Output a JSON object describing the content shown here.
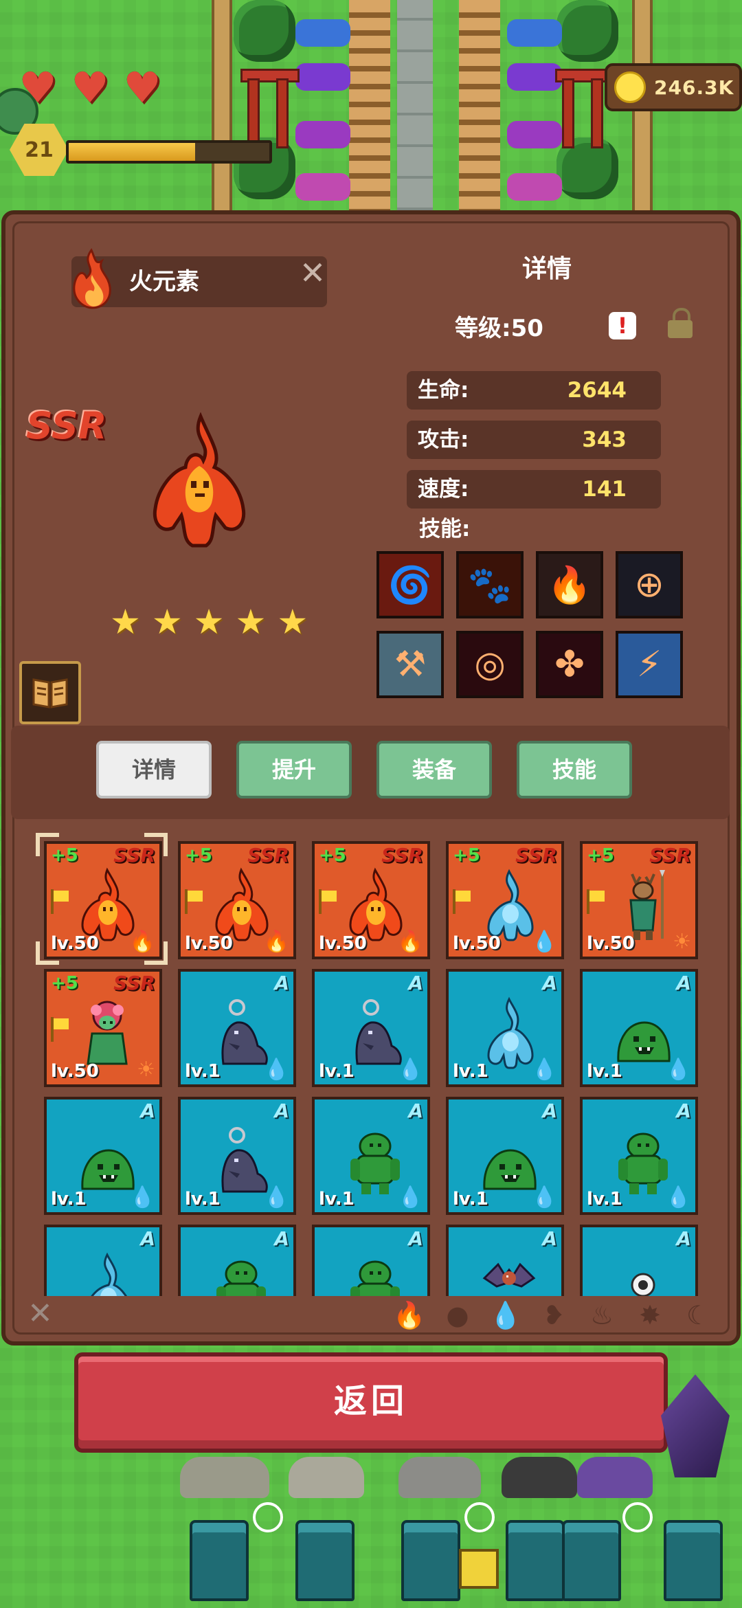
{
  "hud": {
    "player_level": "21",
    "xp_progress": 0.63,
    "hearts": [
      "heart",
      "heart",
      "heart"
    ],
    "gold": "246.3K"
  },
  "hero": {
    "name": "火元素",
    "rarity": "SSR",
    "stars": 5,
    "star_glyph": "★",
    "close_glyph": "✕"
  },
  "details": {
    "title": "详情",
    "level": "等级:50",
    "alert_glyph": "!",
    "stats": [
      {
        "label": "生命:",
        "value": "2644"
      },
      {
        "label": "攻击:",
        "value": "343"
      },
      {
        "label": "速度:",
        "value": "141"
      }
    ],
    "skills_label": "技能:",
    "skills": [
      {
        "icon": "fire-swirl-icon",
        "glyph": "🌀",
        "color": "#6a1a10"
      },
      {
        "icon": "fire-beast-icon",
        "glyph": "🐾",
        "color": "#3a1208"
      },
      {
        "icon": "flame-spirit-icon",
        "glyph": "🔥",
        "color": "#2a1a18"
      },
      {
        "icon": "crosshair-icon",
        "glyph": "⊕",
        "color": "#1a1a24"
      },
      {
        "icon": "pillar-icon",
        "glyph": "⚒",
        "color": "#4a6a7a"
      },
      {
        "icon": "blood-ring-icon",
        "glyph": "◎",
        "color": "#2a0a0e"
      },
      {
        "icon": "blood-drops-icon",
        "glyph": "✤",
        "color": "#2a0a10"
      },
      {
        "icon": "lightning-icon",
        "glyph": "⚡",
        "color": "#2a5a9a"
      }
    ]
  },
  "tabs": [
    {
      "label": "详情",
      "active": true
    },
    {
      "label": "提升",
      "active": false
    },
    {
      "label": "装备",
      "active": false
    },
    {
      "label": "技能",
      "active": false
    }
  ],
  "cards": [
    {
      "rarity": "SSR",
      "bonus": "+5",
      "level": "lv.50",
      "element": "fire",
      "monster": "fire-elemental",
      "flag": true,
      "selected": true
    },
    {
      "rarity": "SSR",
      "bonus": "+5",
      "level": "lv.50",
      "element": "fire",
      "monster": "fire-elemental",
      "flag": true
    },
    {
      "rarity": "SSR",
      "bonus": "+5",
      "level": "lv.50",
      "element": "fire",
      "monster": "fire-elemental",
      "flag": true
    },
    {
      "rarity": "SSR",
      "bonus": "+5",
      "level": "lv.50",
      "element": "water",
      "monster": "water-elemental",
      "flag": true
    },
    {
      "rarity": "SSR",
      "bonus": "+5",
      "level": "lv.50",
      "element": "sun",
      "monster": "deer-spearman",
      "flag": true
    },
    {
      "rarity": "SSR",
      "bonus": "+5",
      "level": "lv.50",
      "element": "sun",
      "monster": "flower-maiden",
      "flag": true
    },
    {
      "rarity": "A",
      "bonus": "",
      "level": "lv.1",
      "element": "water",
      "monster": "shadow-wolf"
    },
    {
      "rarity": "A",
      "bonus": "",
      "level": "lv.1",
      "element": "water",
      "monster": "shadow-wolf"
    },
    {
      "rarity": "A",
      "bonus": "",
      "level": "lv.1",
      "element": "water",
      "monster": "water-elemental"
    },
    {
      "rarity": "A",
      "bonus": "",
      "level": "lv.1",
      "element": "water",
      "monster": "green-slime"
    },
    {
      "rarity": "A",
      "bonus": "",
      "level": "lv.1",
      "element": "water",
      "monster": "green-slime"
    },
    {
      "rarity": "A",
      "bonus": "",
      "level": "lv.1",
      "element": "water",
      "monster": "shadow-wolf"
    },
    {
      "rarity": "A",
      "bonus": "",
      "level": "lv.1",
      "element": "water",
      "monster": "green-golem"
    },
    {
      "rarity": "A",
      "bonus": "",
      "level": "lv.1",
      "element": "water",
      "monster": "green-slime"
    },
    {
      "rarity": "A",
      "bonus": "",
      "level": "lv.1",
      "element": "water",
      "monster": "green-golem"
    },
    {
      "rarity": "A",
      "bonus": "",
      "level": "",
      "element": "",
      "monster": "water-elemental"
    },
    {
      "rarity": "A",
      "bonus": "",
      "level": "",
      "element": "",
      "monster": "green-golem"
    },
    {
      "rarity": "A",
      "bonus": "",
      "level": "",
      "element": "",
      "monster": "green-golem"
    },
    {
      "rarity": "A",
      "bonus": "",
      "level": "",
      "element": "",
      "monster": "bat"
    },
    {
      "rarity": "A",
      "bonus": "",
      "level": "",
      "element": "",
      "monster": "eye-ghost"
    }
  ],
  "filters": [
    {
      "icon": "fire-filter-icon",
      "glyph": "🔥"
    },
    {
      "icon": "earth-filter-icon",
      "glyph": "●"
    },
    {
      "icon": "water-filter-icon",
      "glyph": "💧"
    },
    {
      "icon": "wind-filter-icon",
      "glyph": "❥"
    },
    {
      "icon": "flame-filter-icon",
      "glyph": "♨"
    },
    {
      "icon": "light-filter-icon",
      "glyph": "✸"
    },
    {
      "icon": "dark-filter-icon",
      "glyph": "☾"
    }
  ],
  "close_all_glyph": "✕",
  "return_label": "返回",
  "colors": {
    "panel": "#7b4939",
    "ssr_card": "#e05a2a",
    "a_card": "#12a3c1",
    "tab_green": "#7cc493",
    "return_red": "#d0404a",
    "stat_value": "#ffe36b"
  }
}
